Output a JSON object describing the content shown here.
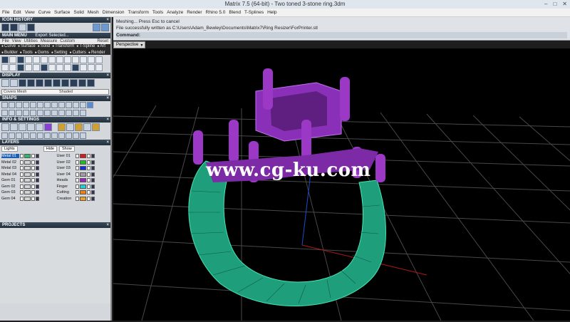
{
  "window": {
    "title": "Matrix 7.5 (64-bit) - Two toned 3-stone ring.3dm"
  },
  "menu": [
    "File",
    "Edit",
    "View",
    "Curve",
    "Surface",
    "Solid",
    "Mesh",
    "Dimension",
    "Transform",
    "Tools",
    "Analyze",
    "Render",
    "Rhino 5.0",
    "Blend",
    "T-Splines",
    "Help"
  ],
  "left_panel": {
    "icon_history_label": "ICON HISTORY",
    "main_menu": {
      "label": "MAIN MENU",
      "export": "Export Selected...",
      "tabs": [
        "File",
        "View",
        "Utilities",
        "Measure",
        "Custom",
        "Reset"
      ],
      "categories": [
        "Curve",
        "Surface",
        "Solid",
        "Transform",
        "T-Spline",
        "Art",
        "Builder",
        "Tools",
        "Gems",
        "Setting",
        "Cutters",
        "Render"
      ]
    },
    "display": {
      "label": "DISPLAY",
      "mode_left": "Covers Mesh",
      "mode_right": "Shaded"
    },
    "snaps_label": "SNAPS",
    "info_label": "INFO & SETTINGS",
    "layers": {
      "label": "LAYERS",
      "hide": "Hide",
      "show": "Show",
      "lights": "Lights",
      "left": [
        {
          "name": "Metal 01",
          "color": "#2fb86a",
          "highlight": true
        },
        {
          "name": "Metal 02",
          "color": "#d4d4d4",
          "highlight": false
        },
        {
          "name": "Metal 03",
          "color": "#d4d4d4",
          "highlight": false
        },
        {
          "name": "Metal 04",
          "color": "#d4d4d4",
          "highlight": false
        },
        {
          "name": "Gem 01",
          "color": "#d4d4d4",
          "highlight": false
        },
        {
          "name": "Gem 02",
          "color": "#d4d4d4",
          "highlight": false
        },
        {
          "name": "Gem 03",
          "color": "#d4d4d4",
          "highlight": false
        },
        {
          "name": "Gem 04",
          "color": "#d4d4d4",
          "highlight": false
        }
      ],
      "right": [
        {
          "name": "User 01",
          "color": "#e01515"
        },
        {
          "name": "User 02",
          "color": "#20c020"
        },
        {
          "name": "User 03",
          "color": "#1530d0"
        },
        {
          "name": "User 04",
          "color": "#a0a0a0"
        },
        {
          "name": "Heads",
          "color": "#a020c0"
        },
        {
          "name": "Finger",
          "color": "#20d0d0"
        },
        {
          "name": "Cutting",
          "color": "#f08010"
        },
        {
          "name": "Creation",
          "color": "#f0a020"
        }
      ]
    },
    "projects_label": "PROJECTS"
  },
  "command_area": {
    "line1": "Meshing... Press Esc to cancel",
    "line2": "File successfully written as C:\\Users\\Adam_Bewley\\Documents\\Matrix7\\Ring Resizer\\ForPrinter.stl",
    "prompt": "Command:"
  },
  "viewport": {
    "tab": "Perspective"
  },
  "watermark": "www.cg-ku.com",
  "colors": {
    "ring": "#2ec39a",
    "head": "#9b39c6",
    "grid": "#4a4a4a"
  }
}
